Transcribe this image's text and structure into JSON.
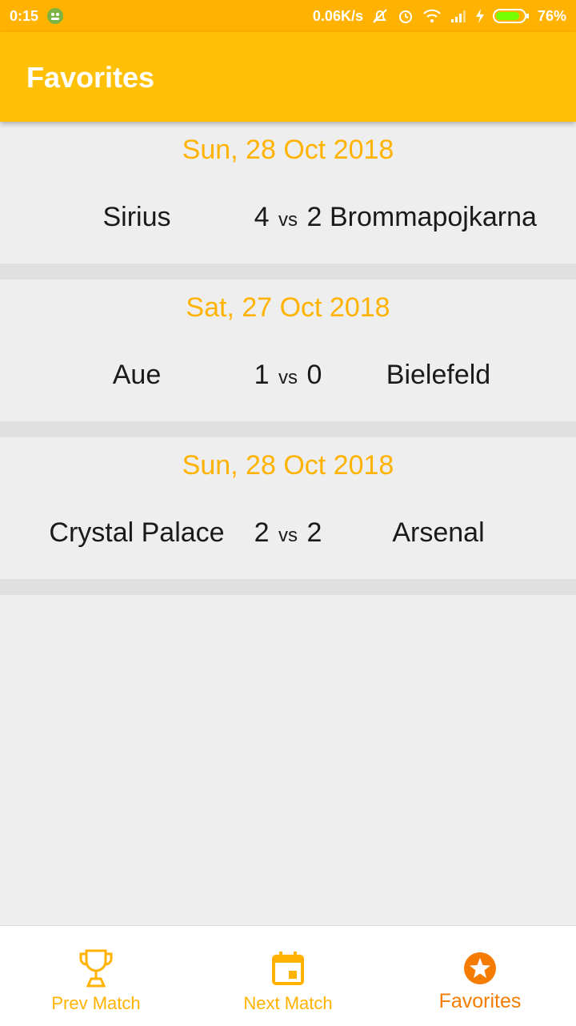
{
  "status_bar": {
    "time": "0:15",
    "network_speed": "0.06K/s",
    "battery": "76%",
    "icons": [
      "app-notification-icon",
      "mute-icon",
      "alarm-icon",
      "wifi-icon",
      "signal-icon",
      "charging-icon",
      "battery-icon"
    ]
  },
  "app_bar": {
    "title": "Favorites"
  },
  "matches": [
    {
      "date": "Sun, 28 Oct 2018",
      "home": "Sirius",
      "home_score": "4",
      "vs": "vs",
      "away_score": "2",
      "away": "Brommapojkarna"
    },
    {
      "date": "Sat, 27 Oct 2018",
      "home": "Aue",
      "home_score": "1",
      "vs": "vs",
      "away_score": "0",
      "away": "Bielefeld"
    },
    {
      "date": "Sun, 28 Oct 2018",
      "home": "Crystal Palace",
      "home_score": "2",
      "vs": "vs",
      "away_score": "2",
      "away": "Arsenal"
    }
  ],
  "bottom_nav": {
    "items": [
      {
        "label": "Prev Match",
        "icon": "trophy-icon",
        "active": false
      },
      {
        "label": "Next Match",
        "icon": "calendar-icon",
        "active": false
      },
      {
        "label": "Favorites",
        "icon": "star-icon",
        "active": true
      }
    ]
  },
  "colors": {
    "primary": "#ffc107",
    "primary_dark": "#ffb300",
    "accent": "#f57c00",
    "background": "#eeeeee"
  }
}
